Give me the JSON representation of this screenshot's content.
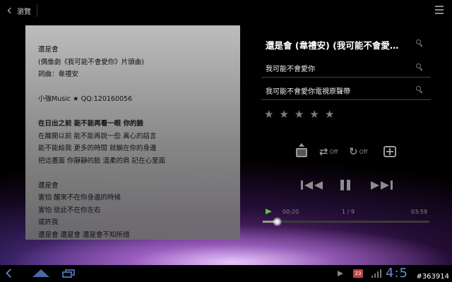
{
  "topbar": {
    "back_label": "瀏覽"
  },
  "lyrics": {
    "lines": [
      {
        "text": "還是會",
        "bold": false
      },
      {
        "text": "(偶像劇《我可能不會愛你》片頭曲)",
        "bold": false
      },
      {
        "text": "詞曲：韋禮安",
        "bold": false
      },
      {
        "text": "",
        "bold": false
      },
      {
        "text": "小強Music ★ QQ:120160056",
        "bold": false
      },
      {
        "text": "",
        "bold": false
      },
      {
        "text": "在日出之前 能不能再看一眼 你的臉",
        "bold": true
      },
      {
        "text": "在離開以前 能不能再說一些 真心的話言",
        "bold": false
      },
      {
        "text": "能不能給我 更多的時間 就躺在你的身邊",
        "bold": false
      },
      {
        "text": "把這畫面 你靜靜的臉 溫柔的肩 記在心里面",
        "bold": false
      },
      {
        "text": "",
        "bold": false
      },
      {
        "text": "還是會",
        "bold": false
      },
      {
        "text": "害怕 醒來不在你身邊的時候",
        "bold": false
      },
      {
        "text": "害怕 從此不在你左右",
        "bold": false
      },
      {
        "text": "或許我",
        "bold": false
      },
      {
        "text": "還是會 還是會 還是會不知所措",
        "bold": false
      }
    ]
  },
  "track": {
    "title": "還是會 (韋禮安) (我可能不會愛…",
    "album": "我可能不會愛你",
    "video": "我可能不會愛你電視原聲帶",
    "rating": 0,
    "rating_max": 5
  },
  "controls": {
    "shuffle_state": "Off",
    "repeat_state": "Off"
  },
  "progress": {
    "elapsed": "00:20",
    "total": "03:59",
    "track_position": "1 / 9",
    "fraction": 0.084
  },
  "system": {
    "clock": "4:5",
    "calendar_day": "23"
  },
  "watermark": "#363914",
  "colors": {
    "accent": "#5cc73a",
    "nav_blue": "#4d67a6",
    "clock_blue": "#6a8acc"
  },
  "icons": {
    "back": "chevron-left-icon",
    "menu": "menu-icon",
    "search": "search-icon",
    "star": "star-icon",
    "playlist": "add-to-playlist-icon",
    "shuffle": "shuffle-icon",
    "repeat": "repeat-icon",
    "effects": "sound-effects-icon",
    "prev": "skip-previous-icon",
    "pause": "pause-icon",
    "next": "skip-next-icon"
  }
}
